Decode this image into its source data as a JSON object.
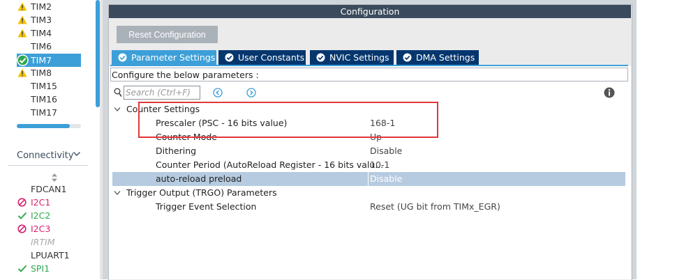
{
  "sidebar": {
    "timers": [
      {
        "label": "TIM2",
        "status": "warning"
      },
      {
        "label": "TIM3",
        "status": "warning"
      },
      {
        "label": "TIM4",
        "status": "warning"
      },
      {
        "label": "TIM6",
        "status": "none"
      },
      {
        "label": "TIM7",
        "status": "ok",
        "selected": true
      },
      {
        "label": "TIM8",
        "status": "warning"
      },
      {
        "label": "TIM15",
        "status": "none"
      },
      {
        "label": "TIM16",
        "status": "none"
      },
      {
        "label": "TIM17",
        "status": "none"
      }
    ],
    "category": "Connectivity",
    "connectivity_items": [
      {
        "label": "FDCAN1",
        "status": "none"
      },
      {
        "label": "I2C1",
        "status": "disabled"
      },
      {
        "label": "I2C2",
        "status": "ok"
      },
      {
        "label": "I2C3",
        "status": "disabled"
      },
      {
        "label": "IRTIM",
        "status": "unavailable"
      },
      {
        "label": "LPUART1",
        "status": "none"
      },
      {
        "label": "SPI1",
        "status": "ok"
      }
    ]
  },
  "config": {
    "title": "Configuration",
    "reset_label": "Reset Configuration",
    "tabs": [
      {
        "label": "Parameter Settings",
        "active": true
      },
      {
        "label": "User Constants",
        "active": false
      },
      {
        "label": "NVIC Settings",
        "active": false
      },
      {
        "label": "DMA Settings",
        "active": false
      }
    ],
    "instruction": "Configure the below parameters :",
    "search_placeholder": "Search (Ctrl+F)",
    "groups": [
      {
        "name": "Counter Settings",
        "params": [
          {
            "name": "Prescaler (PSC - 16 bits value)",
            "value": "168-1"
          },
          {
            "name": "Counter Mode",
            "value": "Up"
          },
          {
            "name": "Dithering",
            "value": "Disable"
          },
          {
            "name": "Counter Period (AutoReload Register - 16 bits valu...",
            "value": "10-1"
          },
          {
            "name": "auto-reload preload",
            "value": "Disable",
            "selected": true
          }
        ]
      },
      {
        "name": "Trigger Output (TRGO) Parameters",
        "params": [
          {
            "name": "Trigger Event Selection",
            "value": "Reset (UG bit from TIMx_EGR)"
          }
        ]
      }
    ]
  },
  "colors": {
    "accent": "#3c9fd8",
    "tab_dark": "#05376e",
    "header": "#3b4a5c",
    "warning": "#f2c200",
    "ok": "#2fa84f",
    "disabled": "#d6236f",
    "highlight": "#e0373a"
  },
  "icons": {
    "warning": "warning-triangle-icon",
    "ok": "check-circle-icon",
    "disabled": "ban-icon",
    "search": "search-icon",
    "info": "info-icon"
  }
}
